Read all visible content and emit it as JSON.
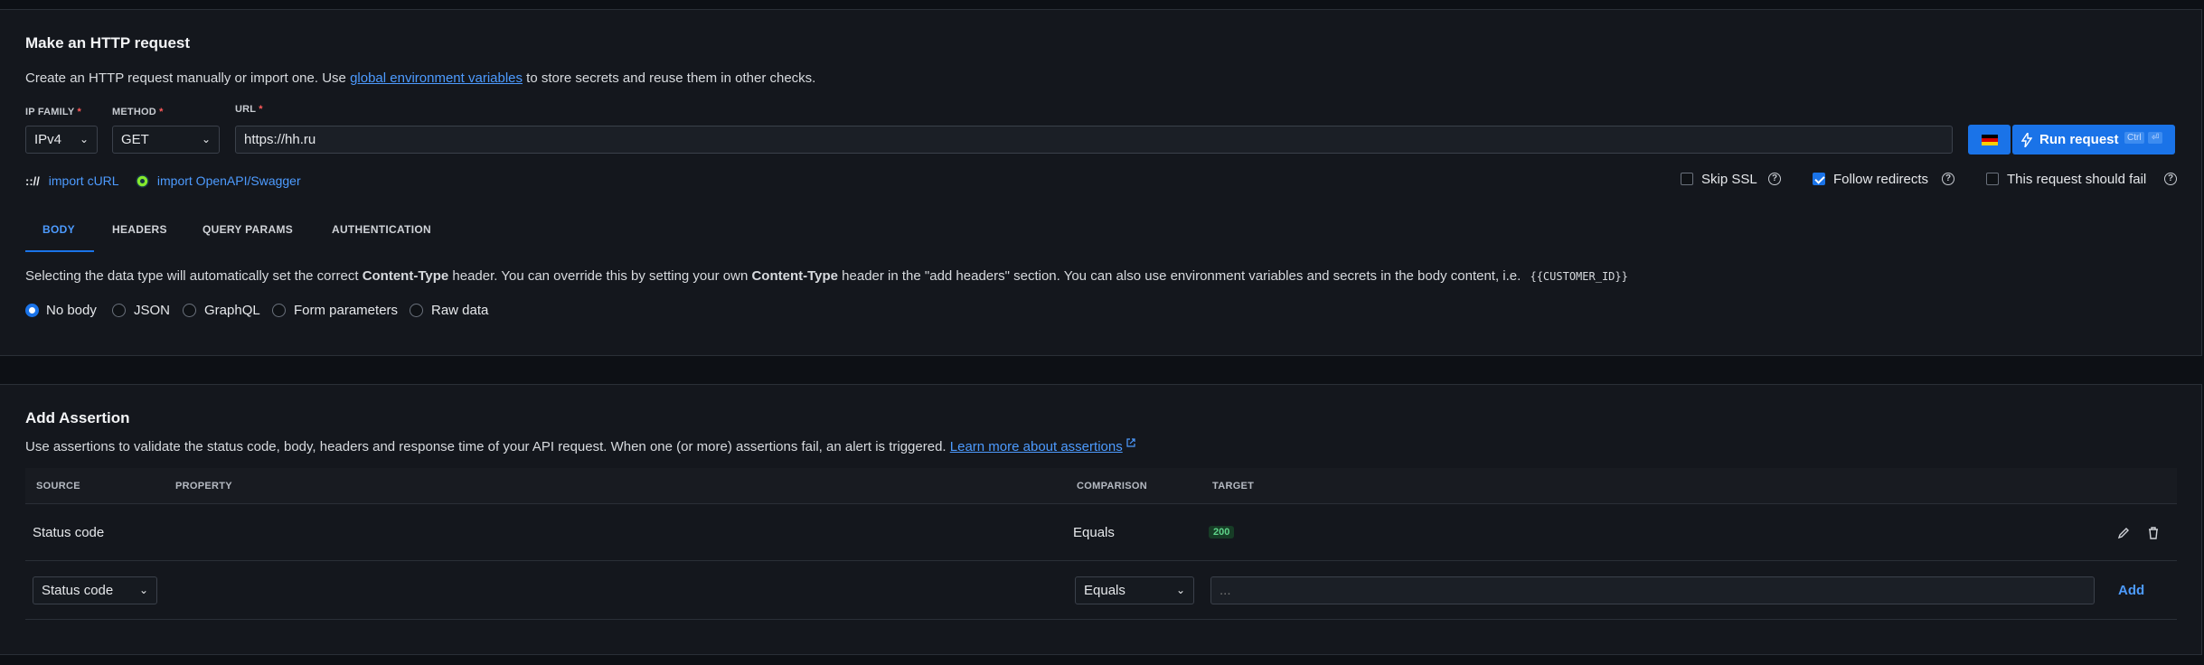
{
  "request": {
    "title": "Make an HTTP request",
    "desc_before": "Create an HTTP request manually or import one. Use ",
    "desc_link": "global environment variables",
    "desc_after": " to store secrets and reuse them in other checks.",
    "ip_family_label": "IP FAMILY",
    "method_label": "METHOD",
    "url_label": "URL",
    "required_mark": "*",
    "ip_family_value": "IPv4",
    "method_value": "GET",
    "url_value": "https://hh.ru",
    "run_label": "Run request",
    "run_key1": "Ctrl",
    "run_key2": "⏎",
    "import_curl_icon": ":://",
    "import_curl": "import cURL",
    "import_openapi": "import OpenAPI/Swagger",
    "skip_ssl": "Skip SSL",
    "follow_redirects": "Follow redirects",
    "should_fail": "This request should fail",
    "help_glyph": "?"
  },
  "tabs": [
    "BODY",
    "HEADERS",
    "QUERY PARAMS",
    "AUTHENTICATION"
  ],
  "body": {
    "text_1": "Selecting the data type will automatically set the correct ",
    "text_bold_1": "Content-Type",
    "text_2": " header. You can override this by setting your own ",
    "text_bold_2": "Content-Type",
    "text_3": " header in the \"add headers\" section. You can also use environment variables and secrets in the body content, i.e.",
    "code": "{{CUSTOMER_ID}}",
    "options": [
      "No body",
      "JSON",
      "GraphQL",
      "Form parameters",
      "Raw data"
    ]
  },
  "assertion": {
    "title": "Add Assertion",
    "desc": "Use assertions to validate the status code, body, headers and response time of your API request. When one (or more) assertions fail, an alert is triggered.",
    "desc_link": "Learn more about assertions",
    "columns": [
      "SOURCE",
      "PROPERTY",
      "COMPARISON",
      "TARGET"
    ],
    "row": {
      "source": "Status code",
      "comparison": "Equals",
      "target": "200"
    },
    "new_source": "Status code",
    "new_comparison": "Equals",
    "new_target_placeholder": "...",
    "add_label": "Add"
  },
  "colors": {
    "accent": "#1a73e8",
    "link": "#4d9bff",
    "success": "#5fd48a"
  },
  "icons": [
    "chevron-down-icon",
    "germany-flag-icon",
    "lightning-icon",
    "curl-icon",
    "swagger-icon",
    "help-icon",
    "external-link-icon",
    "edit-icon",
    "trash-icon"
  ]
}
